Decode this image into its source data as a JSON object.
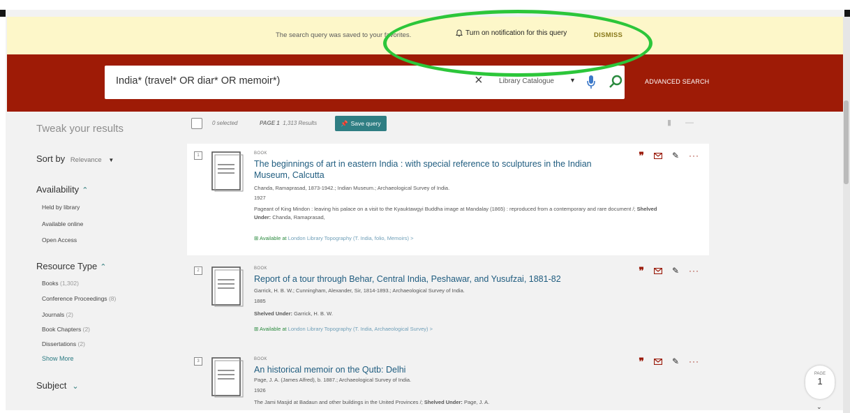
{
  "notice": {
    "message": "The search query was saved to your favorites.",
    "notify_label": "Turn on notification for this query",
    "dismiss_label": "DISMISS"
  },
  "search": {
    "query": "India* (travel* OR diar* OR memoir*)",
    "clear": "×",
    "scope": "Library Catalogue",
    "advanced_label": "ADVANCED SEARCH"
  },
  "sidebar": {
    "title": "Tweak your results",
    "sort_label": "Sort by",
    "sort_value": "Relevance",
    "availability": {
      "label": "Availability",
      "items": [
        "Held by library",
        "Available online",
        "Open Access"
      ]
    },
    "resource_type": {
      "label": "Resource Type",
      "items": [
        {
          "label": "Books",
          "count": "(1,302)"
        },
        {
          "label": "Conference Proceedings",
          "count": "(8)"
        },
        {
          "label": "Journals",
          "count": "(2)"
        },
        {
          "label": "Book Chapters",
          "count": "(2)"
        },
        {
          "label": "Dissertations",
          "count": "(2)"
        }
      ],
      "show_more": "Show More"
    },
    "subject_label": "Subject"
  },
  "toolbar": {
    "selected": "0 selected",
    "page_label": "PAGE 1",
    "results": "1,313 Results",
    "save_label": "Save query"
  },
  "results": [
    {
      "number": "1",
      "type": "BOOK",
      "title": "The beginnings of art in eastern India : with special reference to sculptures in the Indian Museum, Calcutta",
      "authors": "Chanda, Ramaprasad, 1873-1942.; Indian Museum.; Archaeological Survey of India.",
      "year": "1927",
      "desc_text": "Pageant of King Mindon : leaving his palace on a visit to the Kyauktawgyi Buddha image at Mandalay (1865) : reproduced from a contemporary and rare document /; ",
      "desc_label": "Shelved Under:",
      "desc_value": " Chanda, Ramaprasad,",
      "avail": "Available at",
      "location": "London Library  Topography (T. India, folio, Memoirs)  >"
    },
    {
      "number": "2",
      "type": "BOOK",
      "title": "Report of a tour through Behar, Central India, Peshawar, and Yusufzai, 1881-82",
      "authors": "Garrick, H. B. W.; Cunningham, Alexander, Sir, 1814-1893.; Archaeological Survey of India.",
      "year": "1885",
      "desc_label": "Shelved Under:",
      "desc_value": " Garrick, H. B. W.",
      "avail": "Available at",
      "location": "London Library  Topography (T. India, Archaeological Survey)  >"
    },
    {
      "number": "3",
      "type": "BOOK",
      "title": "An historical memoir on the Qutb: Delhi",
      "authors": "Page, J. A. (James Alfred), b. 1887.; Archaeological Survey of India.",
      "year": "1926",
      "desc_text": "The Jami Masjid at Badaun and other buildings in the United Provinces /; ",
      "desc_label": "Shelved Under:",
      "desc_value": " Page, J. A."
    }
  ],
  "page_badge": {
    "label": "PAGE",
    "number": "1"
  },
  "colors": {
    "header_red": "#9e1b06",
    "notice_yellow": "#fdf7c9",
    "accent_teal": "#2f7e83",
    "highlight_green": "#2cc63a",
    "title_blue": "#1f5c7f"
  }
}
